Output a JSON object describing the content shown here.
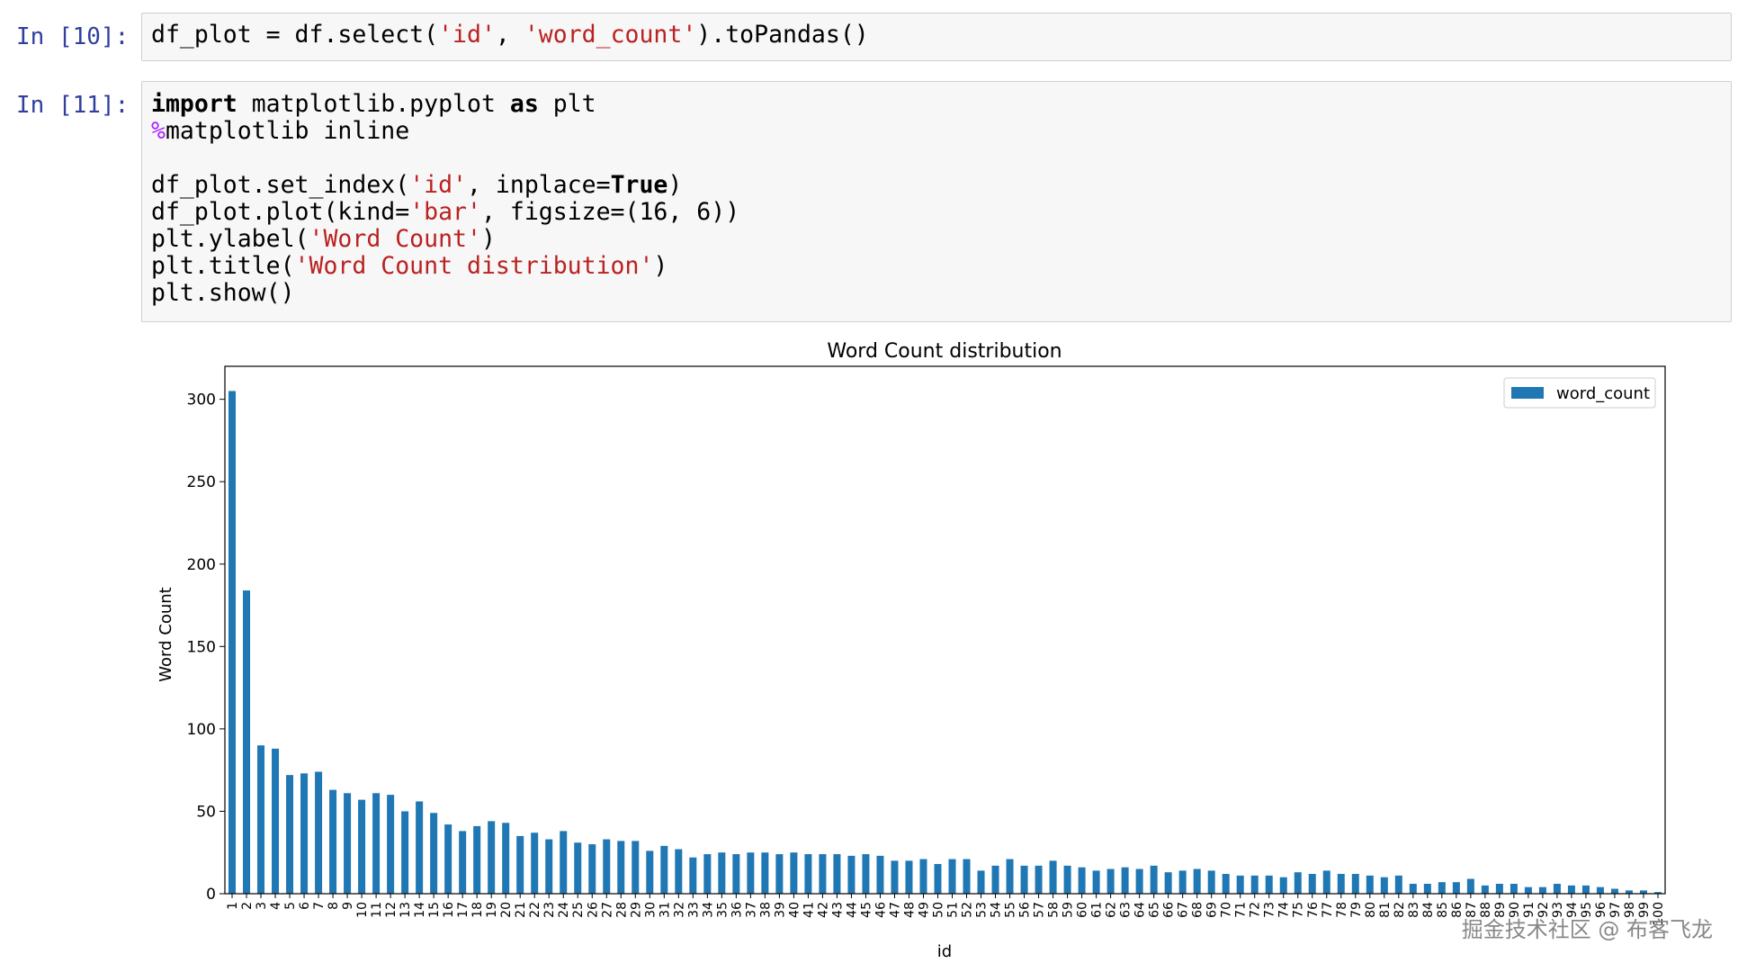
{
  "cells": [
    {
      "prompt": "In [10]:",
      "lines": [
        [
          {
            "t": "df_plot = df.select(",
            "c": "plain"
          },
          {
            "t": "'id'",
            "c": "str"
          },
          {
            "t": ", ",
            "c": "plain"
          },
          {
            "t": "'word_count'",
            "c": "str"
          },
          {
            "t": ").toPandas()",
            "c": "plain"
          }
        ]
      ]
    },
    {
      "prompt": "In [11]:",
      "lines": [
        [
          {
            "t": "import",
            "c": "kw2"
          },
          {
            "t": " matplotlib.pyplot ",
            "c": "plain"
          },
          {
            "t": "as",
            "c": "kw2"
          },
          {
            "t": " plt",
            "c": "plain"
          }
        ],
        [
          {
            "t": "%",
            "c": "mag"
          },
          {
            "t": "matplotlib inline",
            "c": "plain"
          }
        ],
        [
          {
            "t": "",
            "c": "plain"
          }
        ],
        [
          {
            "t": "df_plot.set_index(",
            "c": "plain"
          },
          {
            "t": "'id'",
            "c": "str"
          },
          {
            "t": ", inplace=",
            "c": "plain"
          },
          {
            "t": "True",
            "c": "kw2"
          },
          {
            "t": ")",
            "c": "plain"
          }
        ],
        [
          {
            "t": "df_plot.plot(kind=",
            "c": "plain"
          },
          {
            "t": "'bar'",
            "c": "str"
          },
          {
            "t": ", figsize=(16, 6))",
            "c": "plain"
          }
        ],
        [
          {
            "t": "plt.ylabel(",
            "c": "plain"
          },
          {
            "t": "'Word Count'",
            "c": "str"
          },
          {
            "t": ")",
            "c": "plain"
          }
        ],
        [
          {
            "t": "plt.title(",
            "c": "plain"
          },
          {
            "t": "'Word Count distribution'",
            "c": "str"
          },
          {
            "t": ")",
            "c": "plain"
          }
        ],
        [
          {
            "t": "plt.show()",
            "c": "plain"
          }
        ]
      ]
    }
  ],
  "colors": {
    "bar": "#1f77b4",
    "prompt": "#303F9F",
    "string": "#BA2121"
  },
  "watermark": "掘金技术社区 @ 布客飞龙",
  "chart_data": {
    "type": "bar",
    "title": "Word Count distribution",
    "xlabel": "id",
    "ylabel": "Word Count",
    "ylim": [
      0,
      320
    ],
    "yticks": [
      0,
      50,
      100,
      150,
      200,
      250,
      300
    ],
    "legend": {
      "position": "top-right",
      "entries": [
        "word_count"
      ]
    },
    "grid": false,
    "series": [
      {
        "name": "word_count",
        "categories": [
          "1",
          "2",
          "3",
          "4",
          "5",
          "6",
          "7",
          "8",
          "9",
          "10",
          "11",
          "12",
          "13",
          "14",
          "15",
          "16",
          "17",
          "18",
          "19",
          "20",
          "21",
          "22",
          "23",
          "24",
          "25",
          "26",
          "27",
          "28",
          "29",
          "30",
          "31",
          "32",
          "33",
          "34",
          "35",
          "36",
          "37",
          "38",
          "39",
          "40",
          "41",
          "42",
          "43",
          "44",
          "45",
          "46",
          "47",
          "48",
          "49",
          "50",
          "51",
          "52",
          "53",
          "54",
          "55",
          "56",
          "57",
          "58",
          "59",
          "60",
          "61",
          "62",
          "63",
          "64",
          "65",
          "66",
          "67",
          "68",
          "69",
          "70",
          "71",
          "72",
          "73",
          "74",
          "75",
          "76",
          "77",
          "78",
          "79",
          "80",
          "81",
          "82",
          "83",
          "84",
          "85",
          "86",
          "87",
          "88",
          "89",
          "90",
          "91",
          "92",
          "93",
          "94",
          "95",
          "96",
          "97",
          "98",
          "99",
          "100"
        ],
        "values": [
          305,
          184,
          90,
          88,
          72,
          73,
          74,
          63,
          61,
          57,
          61,
          60,
          50,
          56,
          49,
          42,
          38,
          41,
          44,
          43,
          35,
          37,
          33,
          38,
          31,
          30,
          33,
          32,
          32,
          26,
          29,
          27,
          22,
          24,
          25,
          24,
          25,
          25,
          24,
          25,
          24,
          24,
          24,
          23,
          24,
          23,
          20,
          20,
          21,
          18,
          21,
          21,
          14,
          17,
          21,
          17,
          17,
          20,
          17,
          16,
          14,
          15,
          16,
          15,
          17,
          13,
          14,
          15,
          14,
          12,
          11,
          11,
          11,
          10,
          13,
          12,
          14,
          12,
          12,
          11,
          10,
          11,
          6,
          6,
          7,
          7,
          9,
          5,
          6,
          6,
          4,
          4,
          6,
          5,
          5,
          4,
          3,
          2,
          2,
          1
        ]
      }
    ]
  }
}
